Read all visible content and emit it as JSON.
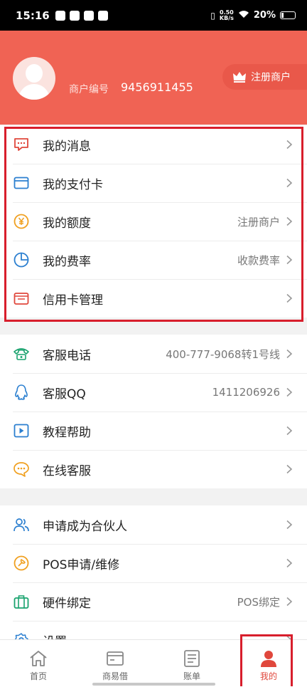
{
  "status_bar": {
    "time": "15:16",
    "net_speed_value": "0.50",
    "net_speed_unit": "KB/s",
    "battery": "20%",
    "battery_level": 0.2
  },
  "header": {
    "merchant_label": "商户编号",
    "merchant_no": "9456911455",
    "register_label": "注册商户"
  },
  "account_group": [
    {
      "label": "我的消息",
      "value": "",
      "icon": "message-icon"
    },
    {
      "label": "我的支付卡",
      "value": "",
      "icon": "card-icon"
    },
    {
      "label": "我的额度",
      "value": "注册商户",
      "icon": "yuan-icon"
    },
    {
      "label": "我的费率",
      "value": "收款费率",
      "icon": "pie-chart-icon"
    },
    {
      "label": "信用卡管理",
      "value": "",
      "icon": "wallet-icon"
    }
  ],
  "service_group": [
    {
      "label": "客服电话",
      "value": "400-777-9068转1号线",
      "icon": "phone-icon"
    },
    {
      "label": "客服QQ",
      "value": "1411206926",
      "icon": "qq-icon"
    },
    {
      "label": "教程帮助",
      "value": "",
      "icon": "play-icon"
    },
    {
      "label": "在线客服",
      "value": "",
      "icon": "chat-icon"
    }
  ],
  "other_group": [
    {
      "label": "申请成为合伙人",
      "value": "",
      "icon": "users-icon"
    },
    {
      "label": "POS申请/维修",
      "value": "",
      "icon": "repair-icon"
    },
    {
      "label": "硬件绑定",
      "value": "POS绑定",
      "icon": "briefcase-icon"
    },
    {
      "label": "设置",
      "value": "",
      "icon": "gear-icon"
    }
  ],
  "tabbar": [
    {
      "label": "首页",
      "icon": "home-icon",
      "active": false
    },
    {
      "label": "商易借",
      "icon": "card-icon",
      "active": false
    },
    {
      "label": "账单",
      "icon": "document-icon",
      "active": false
    },
    {
      "label": "我的",
      "icon": "user-icon",
      "active": true
    }
  ],
  "colors": {
    "brand": "#f06354",
    "highlight": "#d81e2c",
    "active_tab": "#e0473c"
  }
}
